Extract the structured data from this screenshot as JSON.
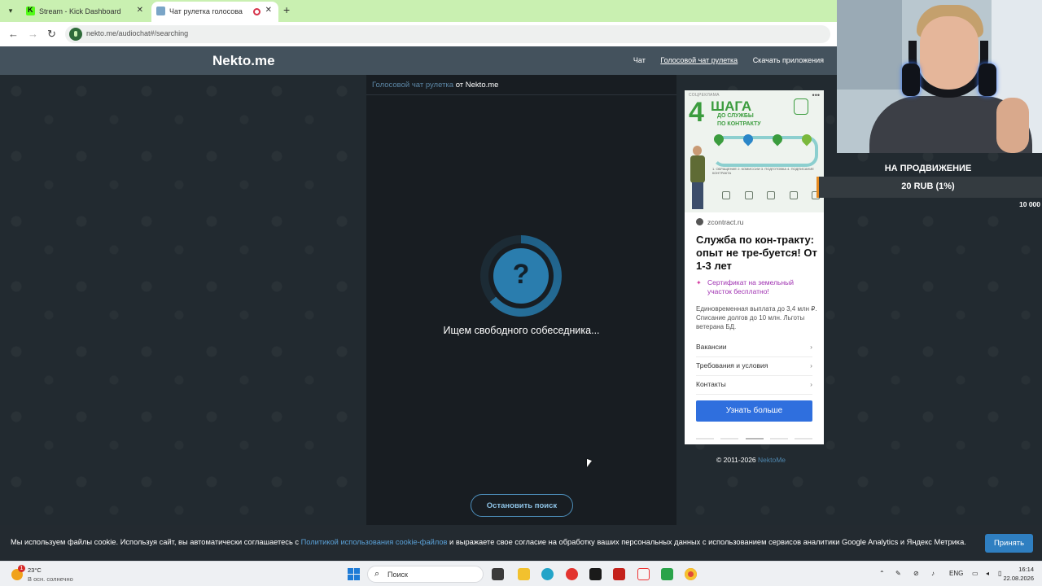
{
  "browser": {
    "tabs": [
      {
        "title": "Stream - Kick Dashboard",
        "favicon": "kick-icon",
        "active": false
      },
      {
        "title": "Чат рулетка голосовая — ",
        "favicon": "nekto-icon",
        "active": true,
        "recording": true
      }
    ],
    "new_tab": "+",
    "url": "nekto.me/audiochat#/searching",
    "tab_bar_color": "#c9f0b1"
  },
  "site": {
    "logo": "Nekto.me",
    "nav": [
      "Чат",
      "Голосовой чат рулетка",
      "Скачать приложения"
    ],
    "nav_current": "Голосовой чат рулетка"
  },
  "chat": {
    "header_link": "Голосовой чат рулетка",
    "header_suffix": " от Nekto.me",
    "spinner_glyph": "?",
    "status": "Ищем свободного собеседника...",
    "stop_button": "Остановить поиск"
  },
  "ad": {
    "badge": "СОЦРЕКЛАМА",
    "banner_number": "4",
    "banner_line1": "ШАГА",
    "banner_line2": "ДО СЛУЖБЫ",
    "banner_line3": "ПО КОНТРАКТУ",
    "steps_caption": "1. ОБРАЩЕНИЕ   2. КОМИССИИ   3. ПОДГОТОВКА   4. ПОДПИСАНИЕ КОНТРАКТА",
    "domain": "zcontract.ru",
    "title": "Служба по кон-тракту: опыт не тре-буется! От 1-3 лет",
    "promo": "Сертификат на земельный участок бесплатно!",
    "description": "Единовременная выплата до 3,4 млн ₽. Списание долгов до 10 млн. Льготы ветерана БД.",
    "links": [
      "Вакансии",
      "Требования и условия",
      "Контакты"
    ],
    "cta": "Узнать больше"
  },
  "copyright": {
    "text": "© 2011-2026 ",
    "brand": "NektoMe"
  },
  "overlay": {
    "promo_title": "НА ПРОДВИЖЕНИЕ",
    "promo_amount": "20 RUB (1%)",
    "promo_progress_percent": 1,
    "promo_goal": "10 000",
    "accent_color": "#e58a20"
  },
  "cookie": {
    "text_before": "Мы используем файлы cookie. Используя сайт, вы автоматически соглашаетесь с ",
    "link": "Политикой использования cookie-файлов",
    "text_after": " и выражаете свое согласие на обработку ваших персональных данных с использованием сервисов аналитики Google Analytics и Яндекс Метрика.",
    "accept": "Принять"
  },
  "taskbar": {
    "weather_temp": "23°C",
    "weather_desc": "В осн. солнечно",
    "weather_badge": "1",
    "search_placeholder": "Поиск",
    "lang": "ENG",
    "time": "16:14",
    "date": "22.08.2026"
  }
}
